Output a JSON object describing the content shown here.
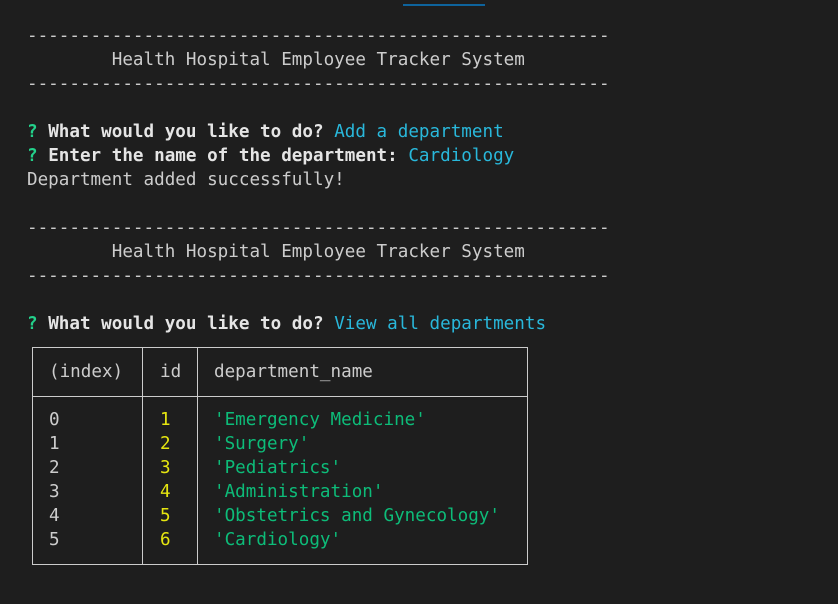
{
  "header": {
    "separator": "-------------------------------------------------------",
    "title": "        Health Hospital Employee Tracker System"
  },
  "session": {
    "prompt_marker": "?",
    "q1_text": "What would you like to do?",
    "q1_answer": "Add a department",
    "q2_text": "Enter the name of the department:",
    "q2_answer": "Cardiology",
    "success_message": "Department added successfully!",
    "q3_text": "What would you like to do?",
    "q3_answer": "View all departments"
  },
  "table": {
    "headers": [
      "(index)",
      "id",
      "department_name"
    ],
    "rows": [
      {
        "index": "0",
        "id": "1",
        "department_name": "'Emergency Medicine'"
      },
      {
        "index": "1",
        "id": "2",
        "department_name": "'Surgery'"
      },
      {
        "index": "2",
        "id": "3",
        "department_name": "'Pediatrics'"
      },
      {
        "index": "3",
        "id": "4",
        "department_name": "'Administration'"
      },
      {
        "index": "4",
        "id": "5",
        "department_name": "'Obstetrics and Gynecology'"
      },
      {
        "index": "5",
        "id": "6",
        "department_name": "'Cardiology'"
      }
    ]
  },
  "colors": {
    "background": "#1e1e1e",
    "prompt_marker": "#23d18b",
    "answer": "#29b8db",
    "id_value": "#e5e510",
    "string_value": "#0dbc79"
  }
}
